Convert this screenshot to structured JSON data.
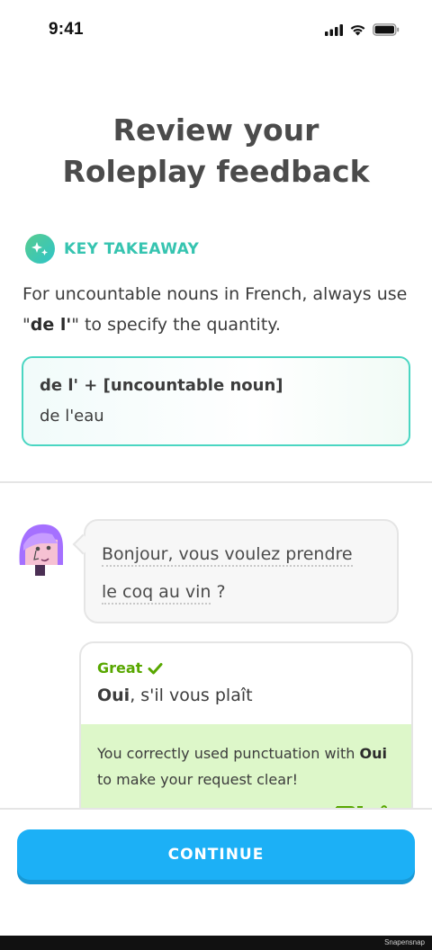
{
  "status_bar": {
    "time": "9:41"
  },
  "title": {
    "line1": "Review your",
    "line2": "Roleplay feedback"
  },
  "takeaway": {
    "label": "KEY TAKEAWAY",
    "text_before": "For uncountable nouns in French, always use \"",
    "text_bold": "de l'",
    "text_after": "\" to specify the quantity.",
    "formula": "de l' + [uncountable noun]",
    "example": "de l'eau"
  },
  "chat": {
    "prompt_line1": "Bonjour, vous voulez prendre",
    "prompt_line2_dotted": "le coq au vin",
    "prompt_line2_end": " ?",
    "answer_status": "Great",
    "answer_word_bold": "Oui",
    "answer_rest": ", s'il vous plaît",
    "feedback_before": "You correctly used punctuation with ",
    "feedback_bold": "Oui",
    "feedback_after": " to make your request clear!"
  },
  "continue_label": "CONTINUE",
  "footer_text": "Snapensnap",
  "colors": {
    "accent_blue": "#1cb0f6",
    "takeaway_teal": "#36c4b0",
    "great_green": "#58a700",
    "feedback_bg": "#ddf7c9"
  },
  "icons": [
    "cellular-signal-icon",
    "wifi-icon",
    "battery-icon",
    "sparkle-icon",
    "checkmark-icon",
    "thumbs-down-icon",
    "thumbs-up-icon"
  ]
}
